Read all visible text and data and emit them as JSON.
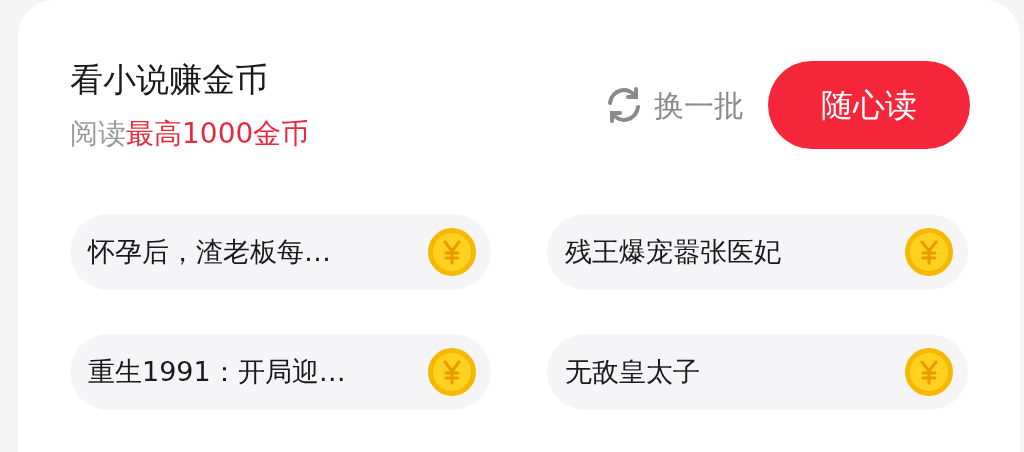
{
  "title": "看小说赚金币",
  "subtitle": "阅读**最高1000金币**",
  "refresh": {
    "label": "换一批"
  },
  "read_button": {
    "label": "随心读"
  },
  "books": [
    {
      "title": "怀孕后，渣老板每…"
    },
    {
      "title": "残王爆宠嚣张医妃"
    },
    {
      "title": "重生1991：开局迎…"
    },
    {
      "title": "无敌皇太子"
    }
  ]
}
